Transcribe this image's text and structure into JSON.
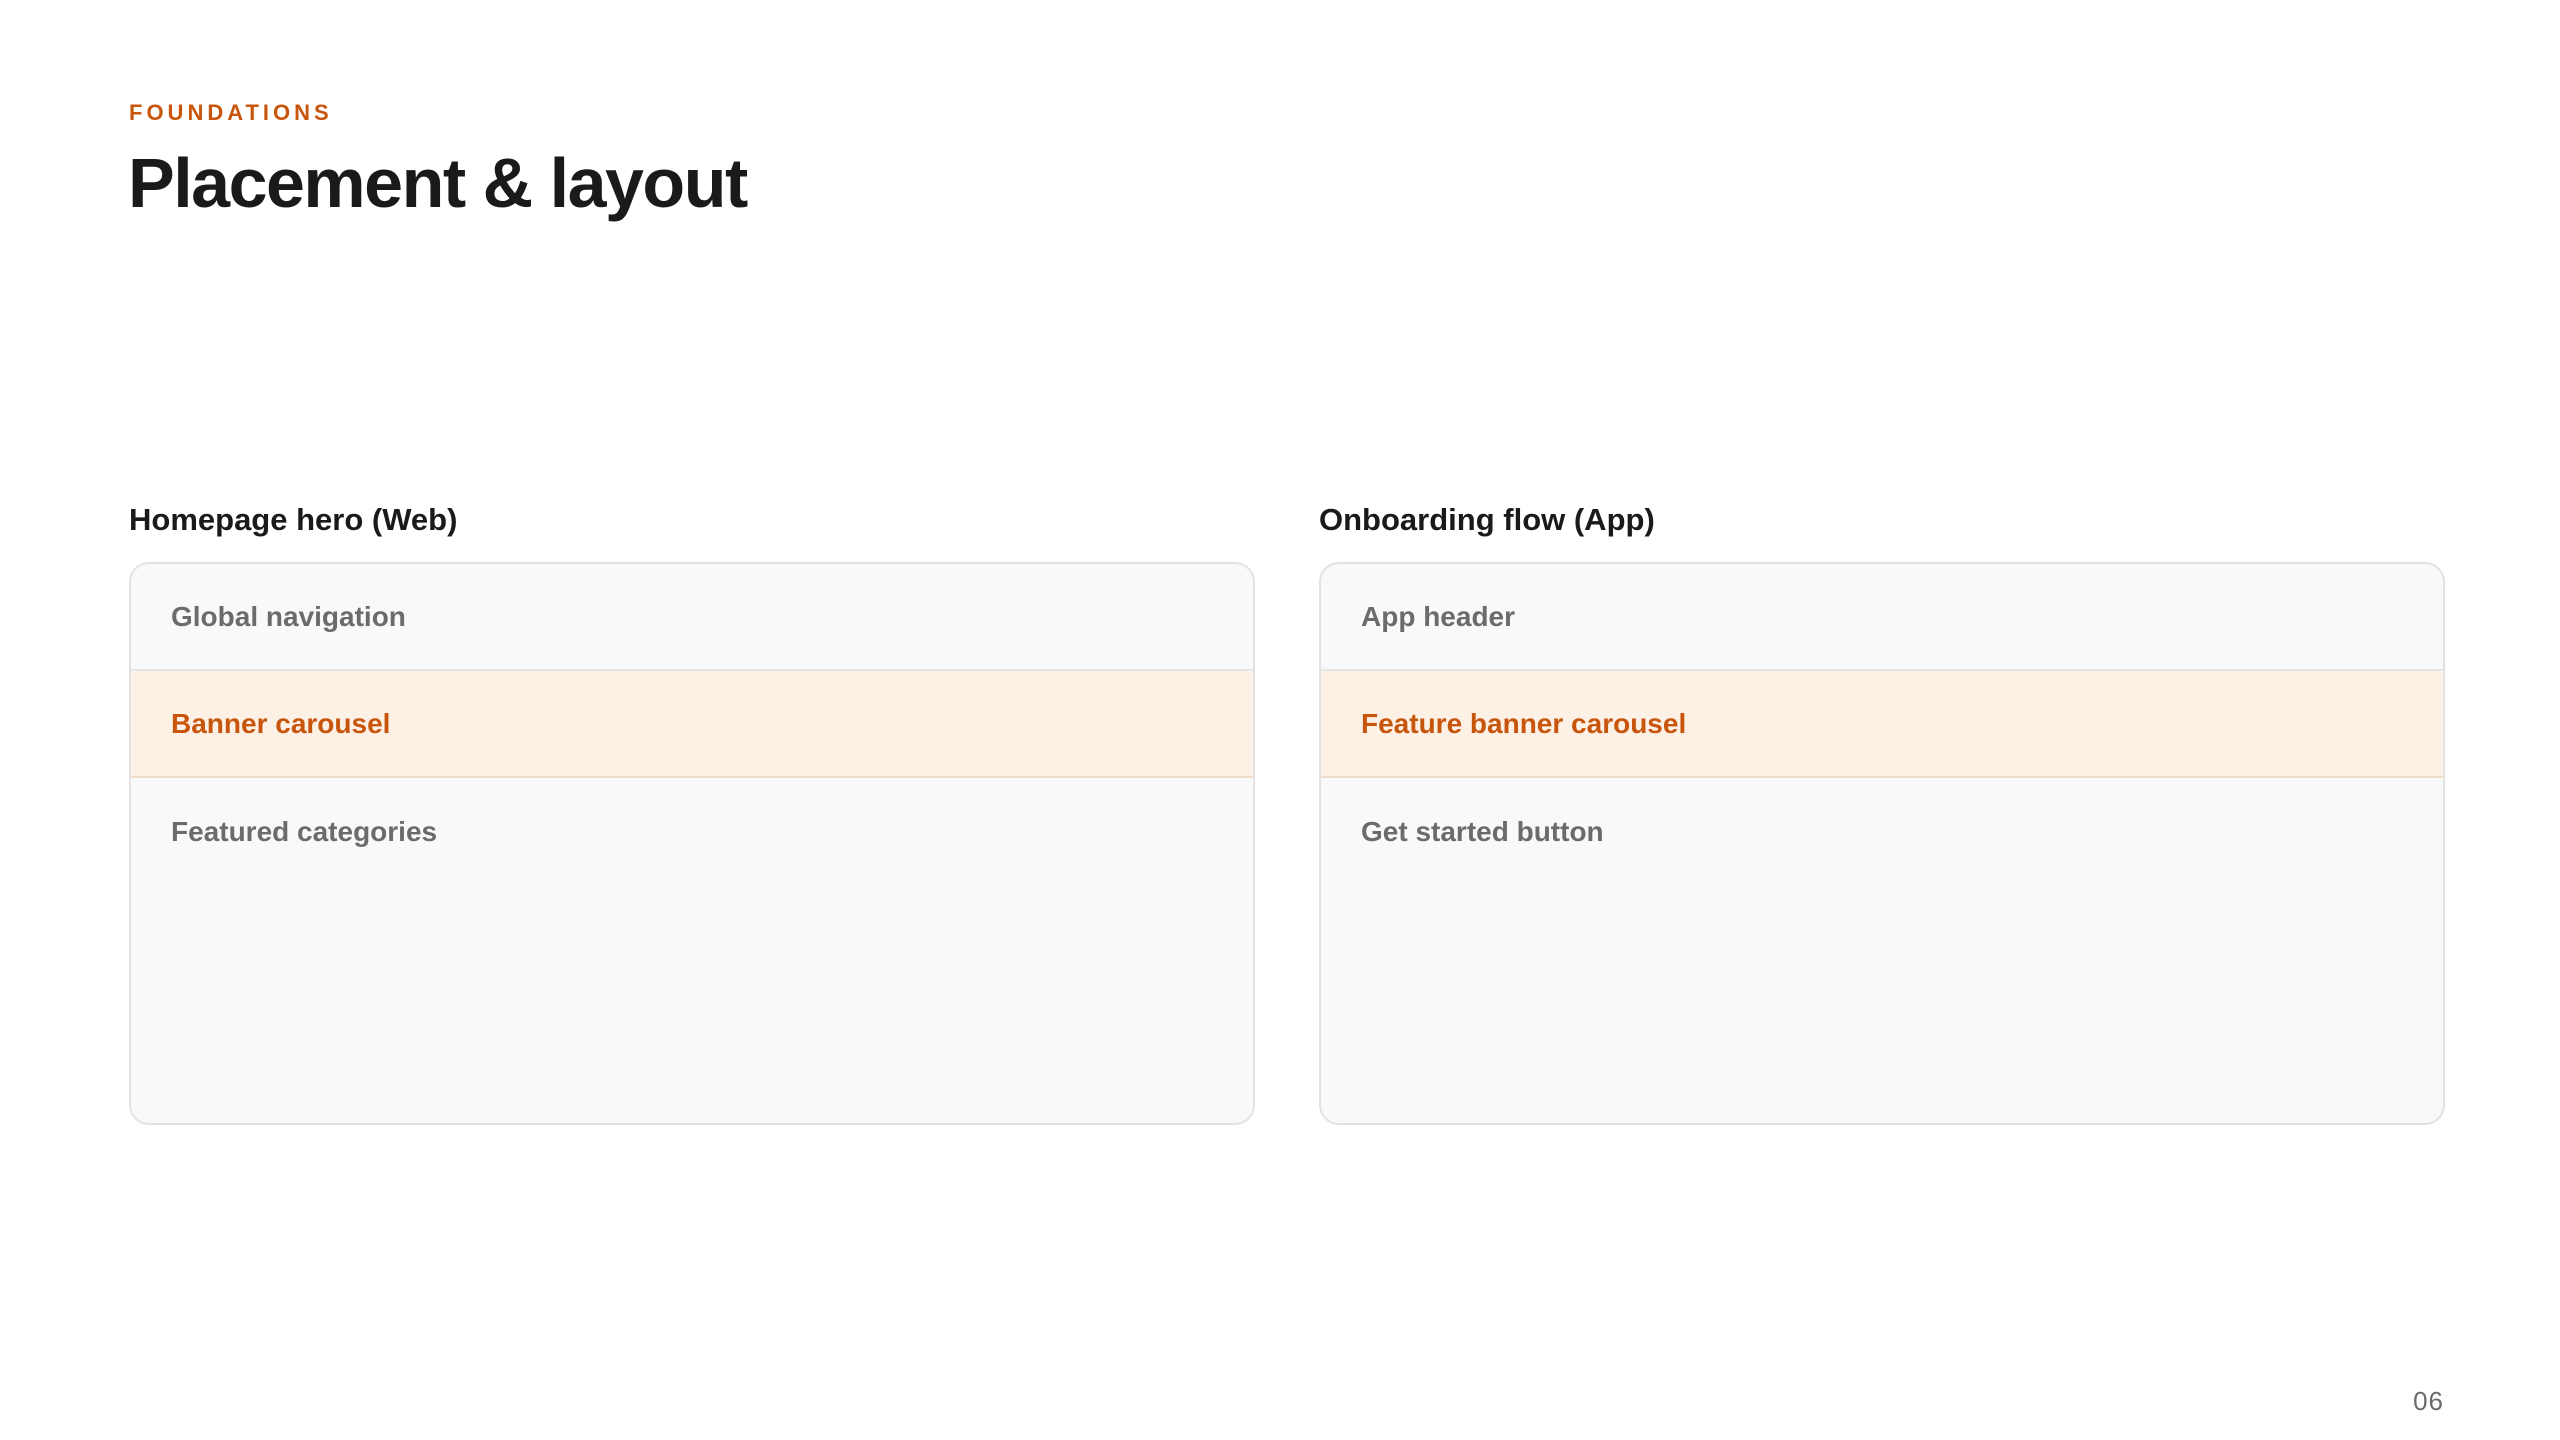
{
  "header": {
    "eyebrow": "FOUNDATIONS",
    "title": "Placement & layout"
  },
  "columns": [
    {
      "heading": "Homepage hero (Web)",
      "rows": [
        {
          "label": "Global navigation",
          "highlighted": false
        },
        {
          "label": "Banner carousel",
          "highlighted": true
        },
        {
          "label": "Featured categories",
          "highlighted": false
        }
      ]
    },
    {
      "heading": "Onboarding flow (App)",
      "rows": [
        {
          "label": "App header",
          "highlighted": false
        },
        {
          "label": "Feature banner carousel",
          "highlighted": true
        },
        {
          "label": "Get started button",
          "highlighted": false
        }
      ]
    }
  ],
  "footer": {
    "page_number": "06"
  },
  "colors": {
    "accent": "#c8550c",
    "highlight_bg": "#fdf1e6",
    "panel_bg": "#f9f9f9",
    "muted_text": "#6b6b6b"
  }
}
